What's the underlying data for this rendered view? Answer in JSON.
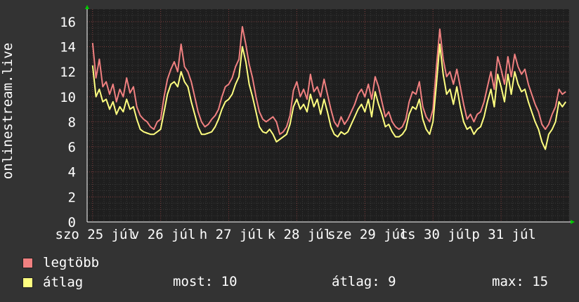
{
  "chart_data": {
    "type": "line",
    "ylabel": "onlinestream.live",
    "ylim": [
      0,
      17
    ],
    "yticks": [
      0,
      2,
      4,
      6,
      8,
      10,
      12,
      14,
      16
    ],
    "grid": true,
    "xtick_labels": [
      "szo 25 júl",
      "v 26 júl",
      "h 27 júl",
      "k 28 júl",
      "sze 29 júl",
      "cs 30 júl",
      "p 31 júl"
    ],
    "day_starts": [
      0,
      1,
      2,
      3,
      4,
      5,
      6
    ],
    "x_range": [
      -0.08,
      7.0
    ],
    "series": [
      {
        "name": "legtöbb",
        "color": "#f08080",
        "x": [
          0.0,
          0.05,
          0.1,
          0.15,
          0.2,
          0.25,
          0.3,
          0.35,
          0.4,
          0.45,
          0.5,
          0.55,
          0.6,
          0.65,
          0.7,
          0.75,
          0.8,
          0.85,
          0.9,
          0.95,
          1.0,
          1.05,
          1.1,
          1.15,
          1.2,
          1.25,
          1.3,
          1.35,
          1.4,
          1.45,
          1.5,
          1.55,
          1.6,
          1.65,
          1.7,
          1.75,
          1.8,
          1.85,
          1.9,
          1.95,
          2.0,
          2.05,
          2.1,
          2.15,
          2.2,
          2.25,
          2.3,
          2.35,
          2.4,
          2.45,
          2.5,
          2.55,
          2.6,
          2.65,
          2.7,
          2.75,
          2.8,
          2.85,
          2.9,
          2.95,
          3.0,
          3.05,
          3.1,
          3.15,
          3.2,
          3.25,
          3.3,
          3.35,
          3.4,
          3.45,
          3.5,
          3.55,
          3.6,
          3.65,
          3.7,
          3.75,
          3.8,
          3.85,
          3.9,
          3.95,
          4.0,
          4.05,
          4.1,
          4.15,
          4.2,
          4.25,
          4.3,
          4.35,
          4.4,
          4.45,
          4.5,
          4.55,
          4.6,
          4.65,
          4.7,
          4.75,
          4.8,
          4.85,
          4.9,
          4.95,
          5.0,
          5.05,
          5.1,
          5.15,
          5.2,
          5.25,
          5.3,
          5.35,
          5.4,
          5.45,
          5.5,
          5.55,
          5.6,
          5.65,
          5.7,
          5.75,
          5.8,
          5.85,
          5.9,
          5.95,
          6.0,
          6.05,
          6.1,
          6.15,
          6.2,
          6.25,
          6.3,
          6.35,
          6.4,
          6.45,
          6.5,
          6.55,
          6.6,
          6.65,
          6.7,
          6.75,
          6.8,
          6.85,
          6.9,
          6.95
        ],
        "y": [
          14.3,
          11.5,
          13.0,
          10.8,
          11.2,
          10.2,
          11.0,
          9.6,
          10.6,
          10.0,
          11.5,
          10.3,
          10.8,
          9.2,
          8.5,
          8.2,
          8.0,
          7.6,
          7.4,
          8.0,
          8.2,
          10.0,
          11.4,
          12.2,
          12.8,
          12.0,
          14.2,
          12.4,
          12.0,
          11.2,
          10.0,
          8.8,
          8.0,
          7.6,
          7.8,
          8.2,
          8.5,
          9.0,
          10.0,
          10.8,
          11.0,
          11.5,
          12.4,
          13.0,
          15.6,
          14.2,
          12.6,
          11.5,
          10.0,
          8.8,
          8.2,
          8.0,
          8.2,
          8.4,
          8.0,
          7.0,
          7.2,
          7.6,
          8.5,
          10.5,
          11.2,
          10.0,
          10.6,
          9.8,
          11.8,
          10.4,
          10.8,
          10.0,
          11.4,
          10.2,
          9.0,
          8.0,
          7.6,
          8.4,
          7.8,
          8.2,
          8.8,
          9.4,
          10.2,
          10.6,
          10.0,
          11.0,
          9.8,
          11.6,
          10.8,
          9.6,
          8.4,
          8.8,
          8.0,
          7.6,
          7.4,
          7.6,
          8.2,
          9.6,
          10.4,
          10.2,
          11.2,
          9.2,
          8.4,
          8.0,
          9.0,
          12.4,
          15.4,
          13.0,
          11.6,
          12.0,
          11.0,
          12.2,
          10.8,
          9.4,
          8.2,
          8.6,
          8.0,
          8.6,
          8.8,
          9.6,
          10.8,
          12.0,
          10.6,
          13.2,
          12.2,
          11.0,
          13.2,
          11.6,
          13.4,
          12.4,
          11.8,
          12.2,
          11.0,
          10.2,
          9.4,
          8.8,
          7.8,
          7.4,
          7.8,
          8.6,
          9.2,
          10.6,
          10.2,
          10.4
        ]
      },
      {
        "name": "átlag",
        "color": "#ffff80",
        "x": [
          0.0,
          0.05,
          0.1,
          0.15,
          0.2,
          0.25,
          0.3,
          0.35,
          0.4,
          0.45,
          0.5,
          0.55,
          0.6,
          0.65,
          0.7,
          0.75,
          0.8,
          0.85,
          0.9,
          0.95,
          1.0,
          1.05,
          1.1,
          1.15,
          1.2,
          1.25,
          1.3,
          1.35,
          1.4,
          1.45,
          1.5,
          1.55,
          1.6,
          1.65,
          1.7,
          1.75,
          1.8,
          1.85,
          1.9,
          1.95,
          2.0,
          2.05,
          2.1,
          2.15,
          2.2,
          2.25,
          2.3,
          2.35,
          2.4,
          2.45,
          2.5,
          2.55,
          2.6,
          2.65,
          2.7,
          2.75,
          2.8,
          2.85,
          2.9,
          2.95,
          3.0,
          3.05,
          3.1,
          3.15,
          3.2,
          3.25,
          3.3,
          3.35,
          3.4,
          3.45,
          3.5,
          3.55,
          3.6,
          3.65,
          3.7,
          3.75,
          3.8,
          3.85,
          3.9,
          3.95,
          4.0,
          4.05,
          4.1,
          4.15,
          4.2,
          4.25,
          4.3,
          4.35,
          4.4,
          4.45,
          4.5,
          4.55,
          4.6,
          4.65,
          4.7,
          4.75,
          4.8,
          4.85,
          4.9,
          4.95,
          5.0,
          5.05,
          5.1,
          5.15,
          5.2,
          5.25,
          5.3,
          5.35,
          5.4,
          5.45,
          5.5,
          5.55,
          5.6,
          5.65,
          5.7,
          5.75,
          5.8,
          5.85,
          5.9,
          5.95,
          6.0,
          6.05,
          6.1,
          6.15,
          6.2,
          6.25,
          6.3,
          6.35,
          6.4,
          6.45,
          6.5,
          6.55,
          6.6,
          6.65,
          6.7,
          6.75,
          6.8,
          6.85,
          6.9,
          6.95
        ],
        "y": [
          12.5,
          10.0,
          10.6,
          9.6,
          9.8,
          9.0,
          9.6,
          8.6,
          9.2,
          8.8,
          9.8,
          9.0,
          9.2,
          8.2,
          7.4,
          7.2,
          7.1,
          7.0,
          7.0,
          7.2,
          7.4,
          8.8,
          10.2,
          11.0,
          11.2,
          10.8,
          12.0,
          11.2,
          10.8,
          9.6,
          8.6,
          7.6,
          7.0,
          7.0,
          7.1,
          7.2,
          7.6,
          8.2,
          9.0,
          9.6,
          9.8,
          10.2,
          11.0,
          11.6,
          14.0,
          12.8,
          11.0,
          10.0,
          8.8,
          7.6,
          7.2,
          7.1,
          7.4,
          7.0,
          6.4,
          6.6,
          6.8,
          7.0,
          7.8,
          9.2,
          9.8,
          9.0,
          9.4,
          8.8,
          10.2,
          9.2,
          9.8,
          8.6,
          9.8,
          8.8,
          7.6,
          7.0,
          6.8,
          7.2,
          7.0,
          7.2,
          7.8,
          8.4,
          9.0,
          9.4,
          8.8,
          9.8,
          8.4,
          10.4,
          9.4,
          8.6,
          7.6,
          7.8,
          7.2,
          6.8,
          6.8,
          7.0,
          7.4,
          8.6,
          9.2,
          9.0,
          9.8,
          8.2,
          7.4,
          7.0,
          8.0,
          11.0,
          14.2,
          11.8,
          10.2,
          10.6,
          9.4,
          10.8,
          9.2,
          8.0,
          7.4,
          7.6,
          7.0,
          7.4,
          7.6,
          8.4,
          9.6,
          10.6,
          9.2,
          11.8,
          10.8,
          9.6,
          11.8,
          10.2,
          12.0,
          11.0,
          10.4,
          10.6,
          9.6,
          8.8,
          8.0,
          7.4,
          6.4,
          5.8,
          7.0,
          7.4,
          8.0,
          9.6,
          9.2,
          9.6
        ]
      }
    ]
  },
  "legend": {
    "items": [
      {
        "label": "legtöbb",
        "color": "#f08080"
      },
      {
        "label": "átlag",
        "color": "#ffff80"
      }
    ],
    "stats": {
      "most": "most: 10",
      "atlag": "átlag: 9",
      "max": "max: 15"
    }
  }
}
